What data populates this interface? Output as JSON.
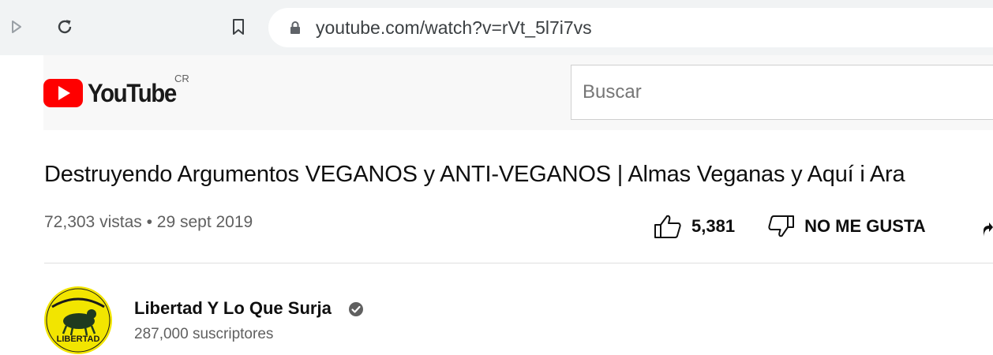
{
  "browser": {
    "url": "youtube.com/watch?v=rVt_5l7i7vs"
  },
  "header": {
    "logo_text": "YouTube",
    "country_code": "CR",
    "search_placeholder": "Buscar"
  },
  "video": {
    "title": "Destruyendo Argumentos VEGANOS y ANTI-VEGANOS | Almas Veganas y Aquí i Ara",
    "views": "72,303 vistas",
    "separator": " • ",
    "date": "29 sept 2019",
    "like_count": "5,381",
    "dislike_label": "NO ME GUSTA"
  },
  "channel": {
    "name": "Libertad Y Lo Que Surja",
    "subscribers": "287,000 suscriptores",
    "avatar_text": "LIBERTAD"
  },
  "colors": {
    "brand_red": "#ff0000",
    "avatar_yellow": "#f2e500",
    "browser_chrome": "#f1f3f4"
  }
}
